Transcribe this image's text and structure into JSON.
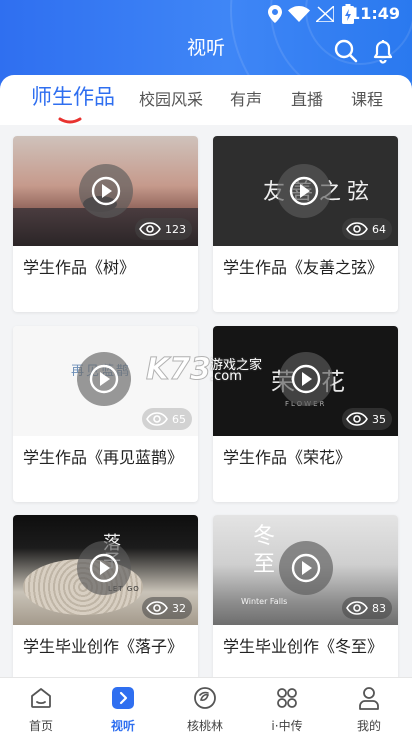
{
  "status": {
    "time": "11:49"
  },
  "header": {
    "title": "视听"
  },
  "tabs": [
    {
      "label": "师生作品"
    },
    {
      "label": "校园风采"
    },
    {
      "label": "有声"
    },
    {
      "label": "直播"
    },
    {
      "label": "课程"
    }
  ],
  "videos": [
    {
      "title": "学生作品《树》",
      "views": "123"
    },
    {
      "title": "学生作品《友善之弦》",
      "views": "64",
      "thumb_text": "友善之弦"
    },
    {
      "title": "学生作品《再见蓝鹊》",
      "views": "65",
      "thumb_text": "再见蓝鹊"
    },
    {
      "title": "学生作品《荣花》",
      "views": "35",
      "thumb_text": "荣花",
      "thumb_subtext": "FLOWER"
    },
    {
      "title": "学生毕业创作《落子》",
      "views": "32",
      "thumb_text": "落子",
      "thumb_subtext": "LET GO"
    },
    {
      "title": "学生毕业创作《冬至》",
      "views": "83",
      "thumb_text": "冬至",
      "thumb_subtext": "Winter Falls"
    }
  ],
  "watermark": {
    "brand": "K73",
    "text": "游戏之家",
    "domain": ".com"
  },
  "bottom_nav": [
    {
      "label": "首页",
      "icon": "home-icon"
    },
    {
      "label": "视听",
      "icon": "play-square-icon",
      "active": true
    },
    {
      "label": "核桃林",
      "icon": "walnut-icon"
    },
    {
      "label": "i·中传",
      "icon": "grid-icon"
    },
    {
      "label": "我的",
      "icon": "person-icon"
    }
  ],
  "colors": {
    "primary": "#2f6ff0",
    "accent_red": "#e8322f"
  }
}
